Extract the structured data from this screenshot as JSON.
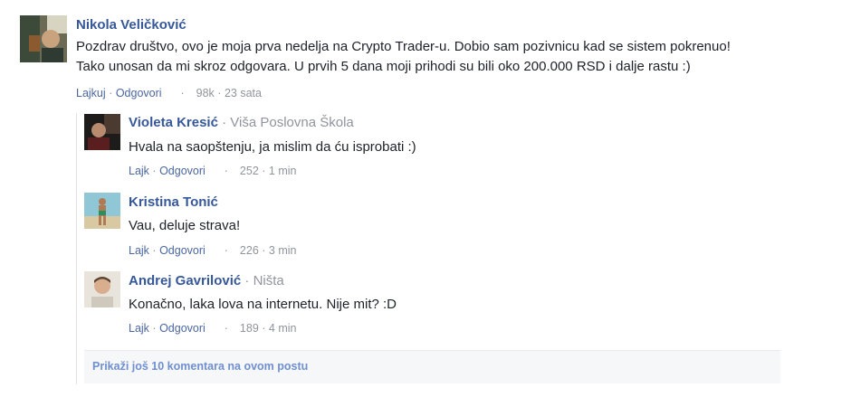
{
  "comments": [
    {
      "author": "Nikola Veličković",
      "affiliation": "",
      "lines": [
        "Pozdrav društvo, ovo je moja prva nedelja na Crypto Trader-u. Dobio sam pozivnicu kad se sistem pokrenuo!",
        "Tako unosan da mi skroz odgovara. U prvih 5 dana moji prihodi su bili oko 200.000 RSD i dalje rastu :)"
      ],
      "like_label": "Lajkuj",
      "reply_label": "Odgovori",
      "likes": "98k",
      "time": "23 sata"
    }
  ],
  "replies": [
    {
      "author": "Violeta Kresić",
      "affiliation": "Viša Poslovna Škola",
      "text": "Hvala na saopštenju, ja mislim da ću isprobati :)",
      "like_label": "Lajk",
      "reply_label": "Odgovori",
      "likes": "252",
      "time": "1 min"
    },
    {
      "author": "Kristina Tonić",
      "affiliation": "",
      "text": "Vau, deluje strava!",
      "like_label": "Lajk",
      "reply_label": "Odgovori",
      "likes": "226",
      "time": "3 min"
    },
    {
      "author": "Andrej Gavrilović",
      "affiliation": "Ništa",
      "text": "Konačno, laka lova na internetu. Nije mit? :D",
      "like_label": "Lajk",
      "reply_label": "Odgovori",
      "likes": "189",
      "time": "4 min"
    }
  ],
  "separators": {
    "dot": "·",
    "affiliation_dot": "· "
  },
  "more_comments_label": "Prikaži još 10 komentara na ovom postu",
  "colors": {
    "name": "#365899",
    "link": "#4b67a1",
    "muted": "#90949c",
    "more_link": "#6f8fd0"
  }
}
